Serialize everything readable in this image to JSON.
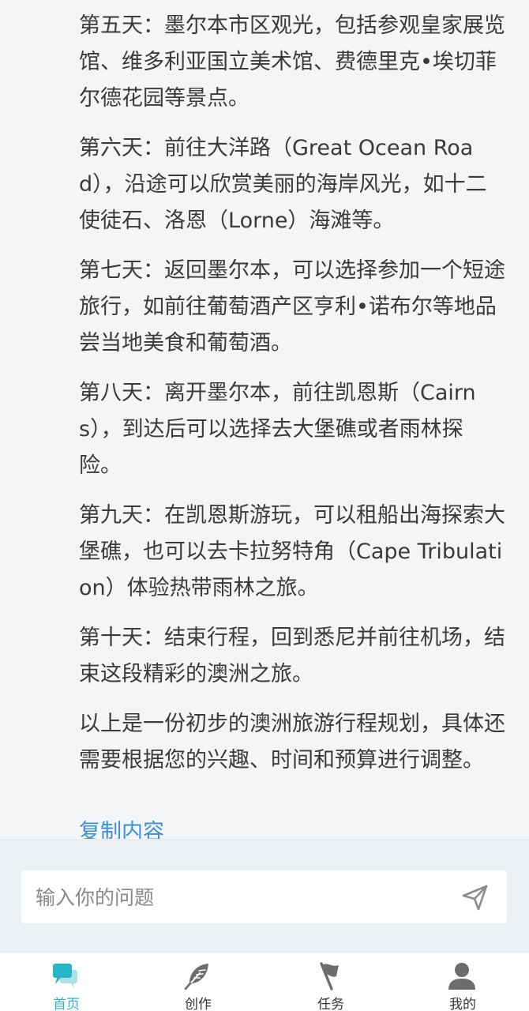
{
  "content": {
    "paragraphs": [
      "第五天：墨尔本市区观光，包括参观皇家展览馆、维多利亚国立美术馆、费德里克•埃切菲尔德花园等景点。",
      "第六天：前往大洋路（Great Ocean Road），沿途可以欣赏美丽的海岸风光，如十二使徒石、洛恩（Lorne）海滩等。",
      "第七天：返回墨尔本，可以选择参加一个短途旅行，如前往葡萄酒产区亨利•诺布尔等地品尝当地美食和葡萄酒。",
      "第八天：离开墨尔本，前往凯恩斯（Cairns），到达后可以选择去大堡礁或者雨林探险。",
      "第九天：在凯恩斯游玩，可以租船出海探索大堡礁，也可以去卡拉努特角（Cape Tribulation）体验热带雨林之旅。",
      "第十天：结束行程，回到悉尼并前往机场，结束这段精彩的澳洲之旅。",
      "以上是一份初步的澳洲旅游行程规划，具体还需要根据您的兴趣、时间和预算进行调整。"
    ],
    "copy_label": "复制内容"
  },
  "input": {
    "placeholder": "输入你的问题",
    "value": ""
  },
  "tabs": [
    {
      "label": "首页",
      "icon": "chat-bubbles-icon",
      "active": true
    },
    {
      "label": "创作",
      "icon": "feather-icon",
      "active": false
    },
    {
      "label": "任务",
      "icon": "flag-icon",
      "active": false
    },
    {
      "label": "我的",
      "icon": "user-icon",
      "active": false
    }
  ],
  "colors": {
    "accent": "#29b5c5",
    "link": "#3d8fd6",
    "text": "#3a3a3a",
    "background": "#f4f5f7"
  }
}
